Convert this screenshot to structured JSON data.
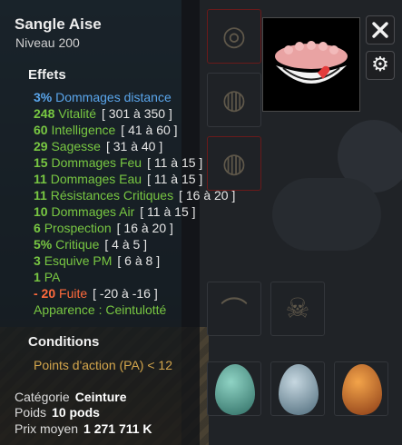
{
  "item": {
    "name": "Sangle Aise",
    "level": "Niveau 200"
  },
  "effects_heading": "Effets",
  "effects": [
    {
      "value": "3%",
      "text": "Dommages distance",
      "range": "",
      "color": "blue"
    },
    {
      "value": "248",
      "text": "Vitalité",
      "range": "[ 301 à 350 ]",
      "color": "green"
    },
    {
      "value": "60",
      "text": "Intelligence",
      "range": "[ 41 à 60 ]",
      "color": "green"
    },
    {
      "value": "29",
      "text": "Sagesse",
      "range": "[ 31 à 40 ]",
      "color": "green"
    },
    {
      "value": "15",
      "text": "Dommages Feu",
      "range": "[ 11 à 15 ]",
      "color": "green"
    },
    {
      "value": "11",
      "text": "Dommages Eau",
      "range": "[ 11 à 15 ]",
      "color": "green"
    },
    {
      "value": "11",
      "text": "Résistances Critiques",
      "range": "[ 16 à 20 ]",
      "color": "green"
    },
    {
      "value": "10",
      "text": "Dommages Air",
      "range": "[ 11 à 15 ]",
      "color": "green"
    },
    {
      "value": "6",
      "text": "Prospection",
      "range": "[ 16 à 20 ]",
      "color": "green"
    },
    {
      "value": "5%",
      "text": "Critique",
      "range": "[ 4 à 5 ]",
      "color": "green"
    },
    {
      "value": "3",
      "text": "Esquive PM",
      "range": "[ 6 à 8 ]",
      "color": "green"
    },
    {
      "value": "1",
      "text": "PA",
      "range": "",
      "color": "green"
    },
    {
      "value": "- 20",
      "text": "Fuite",
      "range": "[ -20 à -16 ]",
      "color": "red"
    },
    {
      "value": "",
      "text": "Apparence : Ceintulotté",
      "range": "",
      "color": "green"
    }
  ],
  "conditions_heading": "Conditions",
  "condition": "Points d'action (PA) < 12",
  "info": {
    "category_label": "Catégorie",
    "category_value": "Ceinture",
    "weight_label": "Poids",
    "weight_value": "10 pods",
    "price_label": "Prix moyen",
    "price_value": "1 271 711 K"
  },
  "buttons": {
    "close_icon": "close-icon",
    "settings_icon": "gear-icon"
  },
  "colors": {
    "green": "#78c742",
    "blue": "#5aa6ec",
    "red": "#ff6a3c",
    "condition": "#d4a64c"
  }
}
